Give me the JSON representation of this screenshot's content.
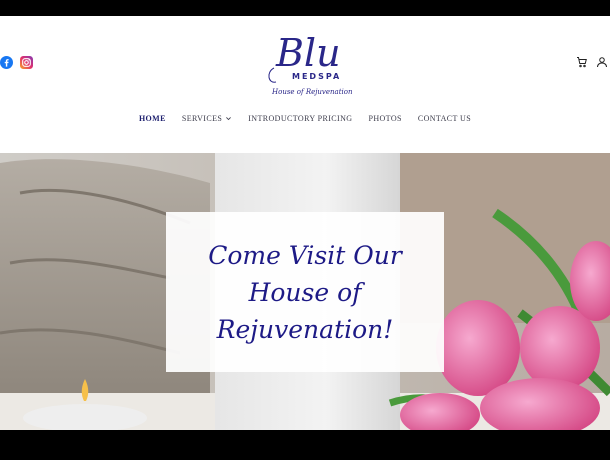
{
  "brand": {
    "logo_name": "Blu",
    "logo_subtitle": "MEDSPA",
    "logo_tagline": "House of Rejuvenation",
    "color": "#2a2789"
  },
  "social": {
    "facebook_icon": "facebook-icon",
    "instagram_icon": "instagram-icon"
  },
  "header_actions": {
    "cart_icon": "cart-icon",
    "account_icon": "account-icon"
  },
  "nav": {
    "items": [
      {
        "label": "HOME"
      },
      {
        "label": "SERVICES"
      },
      {
        "label": "INTRODUCTORY PRICING"
      },
      {
        "label": "PHOTOS"
      },
      {
        "label": "CONTACT US"
      }
    ]
  },
  "hero": {
    "headline_line1": "Come Visit Our",
    "headline_line2": "House of",
    "headline_line3": "Rejuvenation!"
  }
}
